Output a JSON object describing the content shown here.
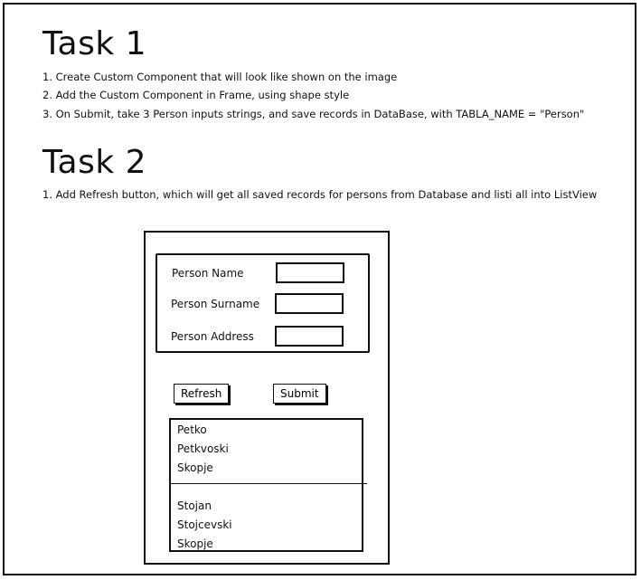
{
  "task1": {
    "title": "Task 1",
    "steps": [
      "1. Create Custom Component that will look like shown on the image",
      "2. Add the Custom Component in Frame, using shape style",
      "3. On Submit, take 3 Person inputs strings, and save records in DataBase, with TABLA_NAME = \"Person\""
    ]
  },
  "task2": {
    "title": "Task 2",
    "steps": [
      "1. Add Refresh button, which will get all saved records for persons from Database and listi all into ListView"
    ]
  },
  "mockup": {
    "form": {
      "name_label": "Person Name",
      "surname_label": "Person Surname",
      "address_label": "Person Address",
      "name_value": "",
      "surname_value": "",
      "address_value": ""
    },
    "buttons": {
      "refresh_label": "Refresh",
      "submit_label": "Submit"
    },
    "list": {
      "records": [
        {
          "name": "Petko",
          "surname": "Petkvoski",
          "address": "Skopje"
        },
        {
          "name": "Stojan",
          "surname": "Stojcevski",
          "address": "Skopje"
        }
      ]
    }
  }
}
